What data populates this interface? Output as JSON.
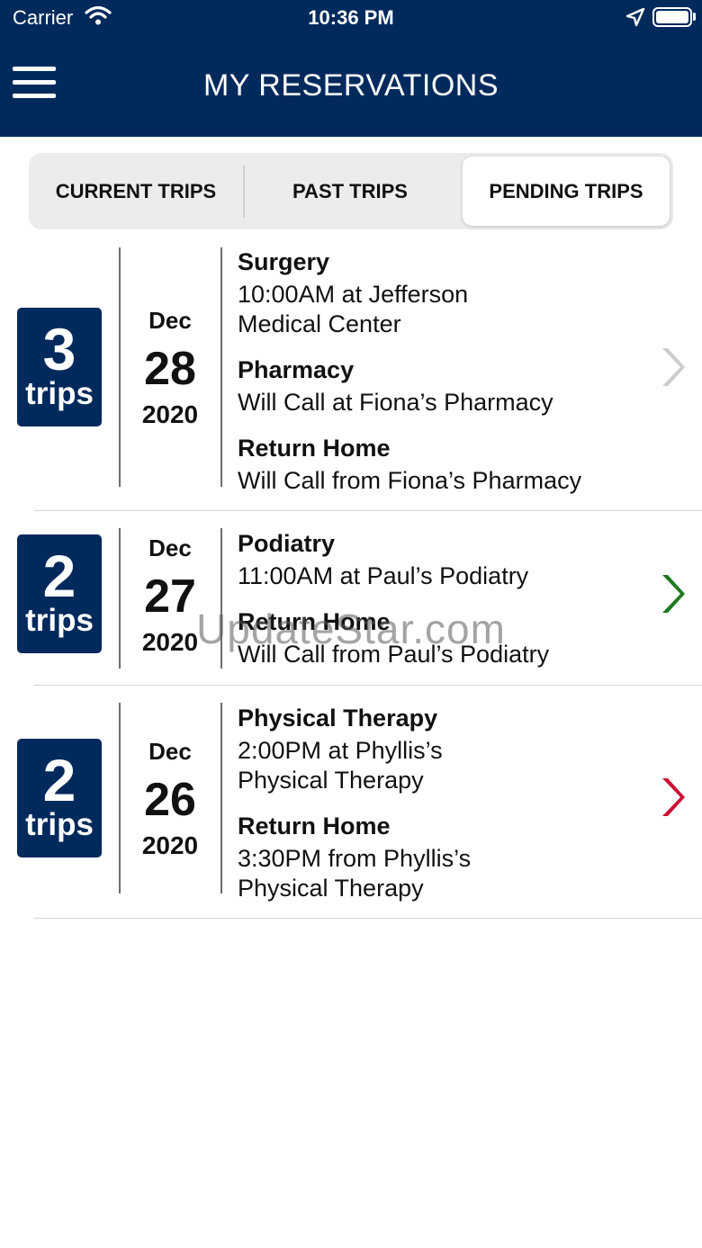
{
  "status_bar": {
    "carrier": "Carrier",
    "time": "10:36 PM",
    "icons": [
      "wifi-icon",
      "location-arrow-icon",
      "battery-icon"
    ]
  },
  "header": {
    "title": "MY RESERVATIONS",
    "menu_icon": "hamburger-menu-icon",
    "background": "#002a5c"
  },
  "tabs": [
    {
      "label": "CURRENT TRIPS",
      "selected": false
    },
    {
      "label": "PAST TRIPS",
      "selected": false
    },
    {
      "label": "PENDING TRIPS",
      "selected": true
    }
  ],
  "reservations": [
    {
      "trip_count": "3",
      "trip_word": "trips",
      "month": "Dec",
      "day": "28",
      "year": "2020",
      "chevron_color": "#cccccc",
      "legs": [
        {
          "title": "Surgery",
          "detail_lines": [
            "10:00AM at Jefferson",
            "Medical Center"
          ]
        },
        {
          "title": "Pharmacy",
          "detail_lines": [
            "Will Call at Fiona’s Pharmacy"
          ]
        },
        {
          "title": "Return Home",
          "detail_lines": [
            "Will Call from Fiona’s Pharmacy"
          ]
        }
      ]
    },
    {
      "trip_count": "2",
      "trip_word": "trips",
      "month": "Dec",
      "day": "27",
      "year": "2020",
      "chevron_color": "#1e7a1e",
      "legs": [
        {
          "title": "Podiatry",
          "detail_lines": [
            "11:00AM at Paul’s Podiatry"
          ]
        },
        {
          "title": "Return Home",
          "detail_lines": [
            "Will Call from Paul’s Podiatry"
          ]
        }
      ]
    },
    {
      "trip_count": "2",
      "trip_word": "trips",
      "month": "Dec",
      "day": "26",
      "year": "2020",
      "chevron_color": "#cc1133",
      "legs": [
        {
          "title": "Physical Therapy",
          "detail_lines": [
            "2:00PM at Phyllis’s",
            "Physical Therapy"
          ]
        },
        {
          "title": "Return Home",
          "detail_lines": [
            "3:30PM from Phyllis’s",
            "Physical Therapy"
          ]
        }
      ]
    }
  ],
  "watermark": "UpdateStar.com",
  "colors": {
    "brand_navy": "#002a5c",
    "tab_background": "#ececec"
  }
}
